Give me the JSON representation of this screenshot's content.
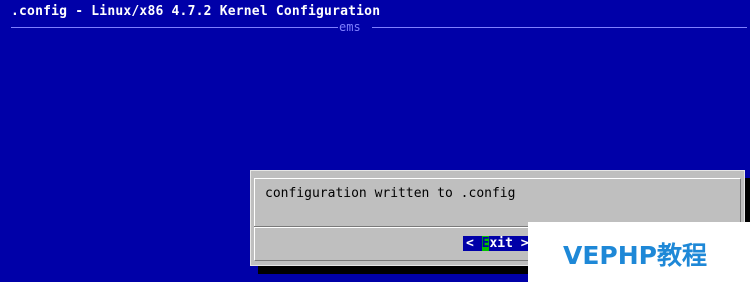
{
  "window": {
    "title": ".config - Linux/x86 4.7.2 Kernel Configuration",
    "menu_label": "ems"
  },
  "dialog": {
    "message": "configuration written to .config",
    "exit_button": {
      "left_bracket": "<",
      "hotkey": "E",
      "label_rest": "xit",
      "right_bracket": ">"
    }
  },
  "watermark": {
    "text": "VEPHP教程"
  },
  "colors": {
    "background": "#0000a8",
    "dialog": "#bfbfbf",
    "hotkey": "#00c000",
    "watermark_text": "#1e88d7"
  }
}
